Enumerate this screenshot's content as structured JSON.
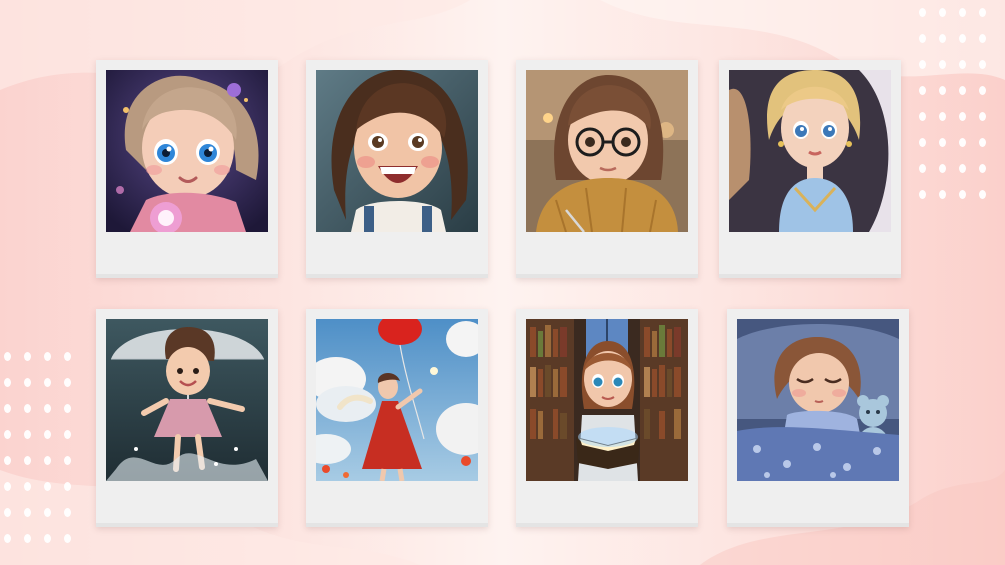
{
  "slide": {
    "background_colors": [
      "#fbd3cf",
      "#fef3f0",
      "#fbd0cb"
    ],
    "frame_color": "#efefef"
  },
  "photos": [
    {
      "id": "girl-magic-flower",
      "icon": "girl-with-glowing-flower-illustration"
    },
    {
      "id": "girl-laughing",
      "icon": "laughing-girl-illustration"
    },
    {
      "id": "girl-glasses-sweater",
      "icon": "girl-with-glasses-writing-illustration"
    },
    {
      "id": "girl-princess-mirror",
      "icon": "princess-at-mirror-illustration"
    },
    {
      "id": "girl-umbrella-splash",
      "icon": "girl-with-umbrella-illustration"
    },
    {
      "id": "girl-red-balloon",
      "icon": "girl-with-red-balloon-illustration"
    },
    {
      "id": "girl-library-book",
      "icon": "girl-reading-glowing-book-illustration"
    },
    {
      "id": "girl-sleeping-teddy",
      "icon": "girl-sleeping-with-teddy-illustration"
    }
  ]
}
